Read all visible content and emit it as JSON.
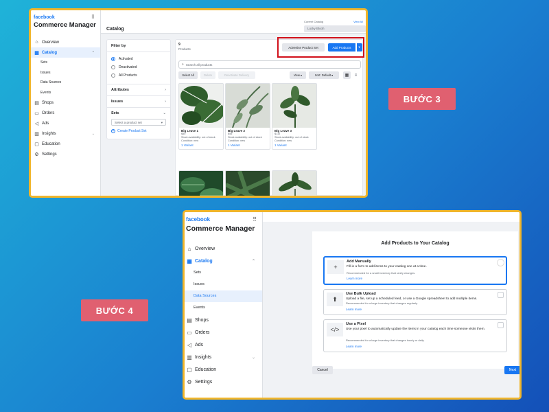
{
  "badges": {
    "step3": "BƯỚC 3",
    "step4": "BƯỚC 4"
  },
  "app": {
    "brand": "facebook",
    "title": "Commerce Manager"
  },
  "sidebar": {
    "items": [
      {
        "label": "Overview",
        "icon": "home-icon"
      },
      {
        "label": "Catalog",
        "icon": "grid-icon"
      },
      {
        "label": "Shops",
        "icon": "shop-icon"
      },
      {
        "label": "Orders",
        "icon": "orders-icon"
      },
      {
        "label": "Ads",
        "icon": "megaphone-icon"
      },
      {
        "label": "Insights",
        "icon": "chart-icon"
      },
      {
        "label": "Education",
        "icon": "education-icon"
      },
      {
        "label": "Settings",
        "icon": "gear-icon"
      }
    ],
    "catalog_sub": [
      "Sets",
      "Issues",
      "Data Sources",
      "Events"
    ]
  },
  "catalog": {
    "page_title": "Catalog",
    "current_catalog_label": "Current Catalog",
    "view_all": "View All",
    "current_catalog_value": "Lucky Blooh",
    "count": "9",
    "count_label": "Products",
    "advertise_btn": "Advertise Product Set",
    "add_btn": "Add Products",
    "search_placeholder": "Search all products",
    "select_all": "Select All",
    "delete": "Delete",
    "deactivate": "Deactivate Delivery",
    "view": "View",
    "sort": "Sort: Default",
    "filter": {
      "title": "Filter by",
      "options": [
        "Activated",
        "Deactivated",
        "All Products"
      ],
      "attributes": "Attributes",
      "issues": "Issues",
      "sets": "Sets",
      "set_placeholder": "Select a product set",
      "create_set": "Create Product Set"
    },
    "products": [
      {
        "name": "Big Leave 1",
        "price": "$50",
        "stock": "Stock availability: out of stock",
        "condition": "Condition: new",
        "variant": "1 Variant"
      },
      {
        "name": "Big Leave 2",
        "price": "$55",
        "stock": "Stock availability: out of stock",
        "condition": "Condition: new",
        "variant": "1 Variant"
      },
      {
        "name": "Big Leave 3",
        "price": "$110",
        "stock": "Stock availability: out of stock",
        "condition": "Condition: new",
        "variant": "1 Variant"
      }
    ]
  },
  "add_modal": {
    "title": "Add Products to Your Catalog",
    "options": [
      {
        "title": "Add Manually",
        "desc": "Fill in a form to add items to your catalog one at a time.",
        "rec": "Recommended for a small inventory that rarely changes.",
        "learn": "Learn more",
        "icon": "plus-icon"
      },
      {
        "title": "Use Bulk Upload",
        "desc": "Upload a file, set up a scheduled feed, or use a Google spreadsheet to add multiple items.",
        "rec": "Recommended for a large inventory that changes regularly.",
        "learn": "Learn more",
        "icon": "upload-icon"
      },
      {
        "title": "Use a Pixel",
        "desc": "Use your pixel to automatically update the items in your catalog each time someone visits them.",
        "rec": "Recommended for a large inventory that changes hourly or daily.",
        "learn": "Learn more",
        "icon": "code-icon"
      }
    ],
    "cancel": "Cancel",
    "next": "Next"
  },
  "colors": {
    "accent": "#1877f2",
    "highlight": "#d1101a",
    "badge": "#e06070",
    "frame": "#f0b52a"
  }
}
